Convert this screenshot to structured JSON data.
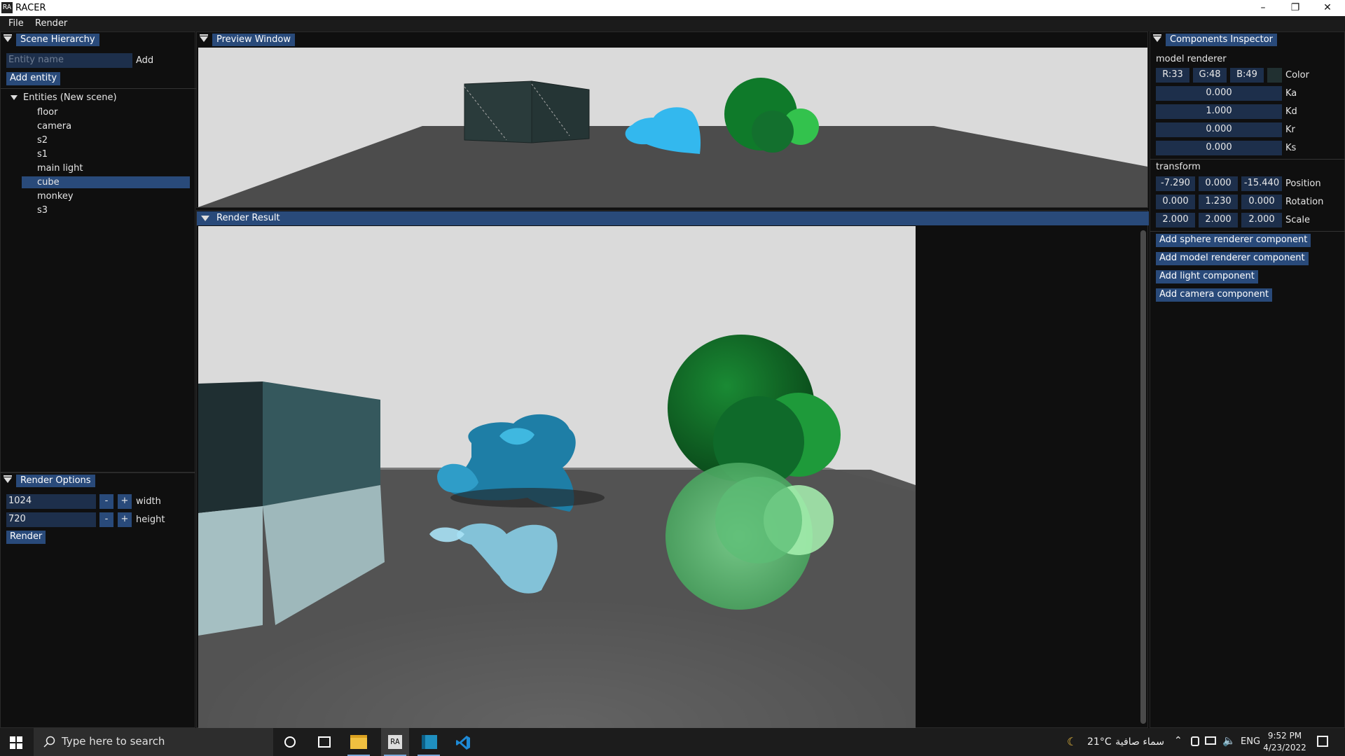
{
  "window": {
    "title": "RACER",
    "logo_text": "RA"
  },
  "menu": [
    "File",
    "Render"
  ],
  "scene_hierarchy": {
    "title": "Scene Hierarchy",
    "entity_name_placeholder": "Entity name",
    "add_label": "Add",
    "add_entity_label": "Add entity",
    "root_label": "Entities (New scene)",
    "entities": [
      "floor",
      "camera",
      "s2",
      "s1",
      "main light",
      "cube",
      "monkey",
      "s3"
    ],
    "selected": "cube"
  },
  "render_options": {
    "title": "Render Options",
    "width_value": "1024",
    "width_label": "width",
    "height_value": "720",
    "height_label": "height",
    "minus": "-",
    "plus": "+",
    "render_label": "Render"
  },
  "preview": {
    "title": "Preview Window"
  },
  "render_result": {
    "title": "Render Result"
  },
  "inspector": {
    "title": "Components Inspector",
    "model_renderer_label": "model renderer",
    "color": {
      "r": "R:33",
      "g": "G:48",
      "b": "B:49",
      "label": "Color"
    },
    "ka": {
      "value": "0.000",
      "label": "Ka"
    },
    "kd": {
      "value": "1.000",
      "label": "Kd"
    },
    "kr": {
      "value": "0.000",
      "label": "Kr"
    },
    "ks": {
      "value": "0.000",
      "label": "Ks"
    },
    "transform_label": "transform",
    "position": {
      "x": "-7.290",
      "y": "0.000",
      "z": "-15.440",
      "label": "Position"
    },
    "rotation": {
      "x": "0.000",
      "y": "1.230",
      "z": "0.000",
      "label": "Rotation"
    },
    "scale": {
      "x": "2.000",
      "y": "2.000",
      "z": "2.000",
      "label": "Scale"
    },
    "buttons": {
      "sphere": "Add sphere renderer component",
      "model": "Add model renderer component",
      "light": "Add light component",
      "camera": "Add camera component"
    }
  },
  "taskbar": {
    "search_placeholder": "Type here to search",
    "weather": "21°C",
    "weather_desc": "سماء صافية",
    "lang": "ENG",
    "time": "9:52 PM",
    "date": "4/23/2022"
  },
  "colors": {
    "accent": "#294a7a",
    "field": "#1d2f4b",
    "selected_row": "#294a7a"
  }
}
